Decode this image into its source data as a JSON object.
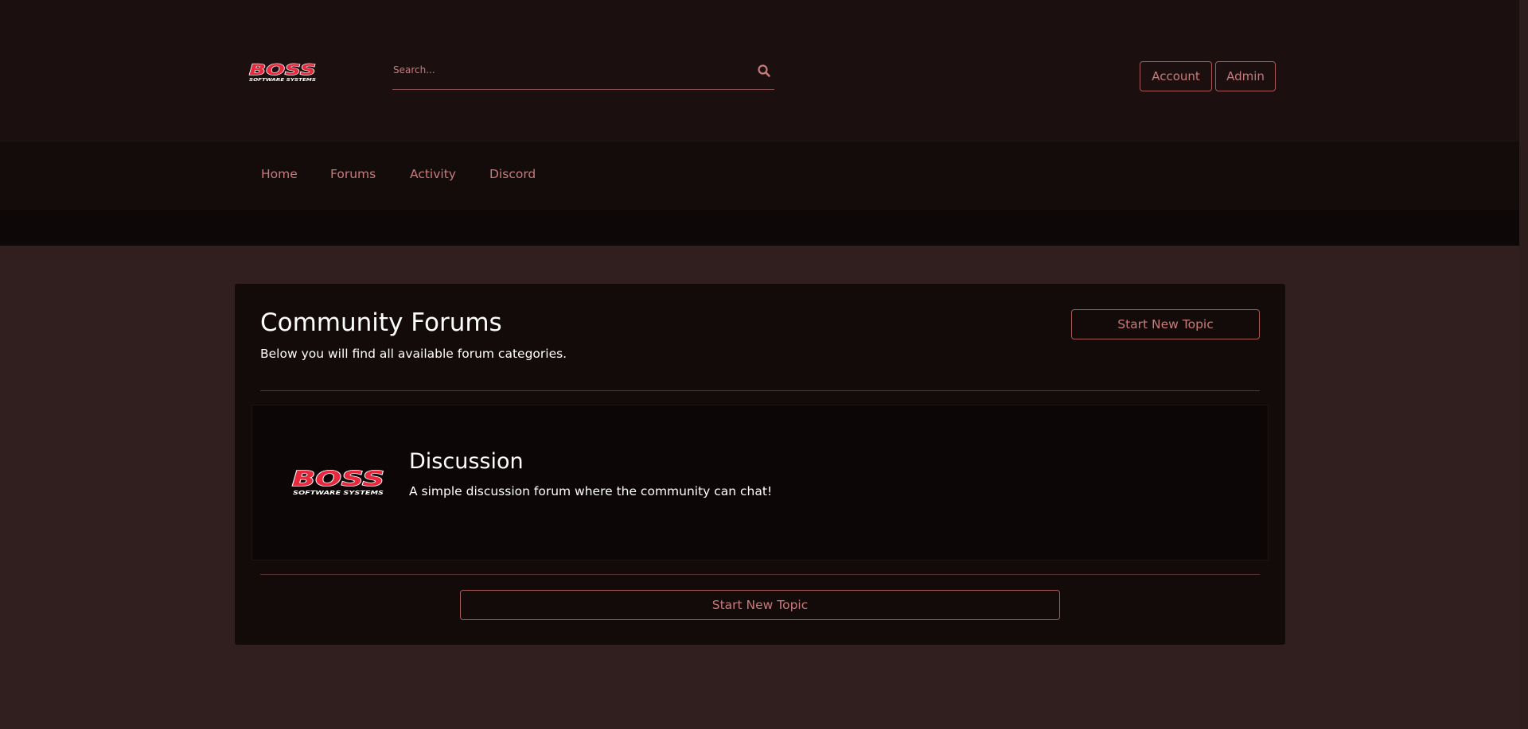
{
  "site": {
    "logo_text": "BOSS",
    "logo_subtext": "SOFTWARE SYSTEMS"
  },
  "header": {
    "search_placeholder": "Search...",
    "search_icon": "search-icon",
    "account_label": "Account",
    "admin_label": "Admin"
  },
  "nav": {
    "items": [
      {
        "label": "Home"
      },
      {
        "label": "Forums"
      },
      {
        "label": "Activity"
      },
      {
        "label": "Discord"
      }
    ]
  },
  "main": {
    "title": "Community Forums",
    "subtitle": "Below you will find all available forum categories.",
    "start_topic_label": "Start New Topic",
    "categories": [
      {
        "name": "Discussion",
        "description": "A simple discussion forum where the community can chat!"
      }
    ],
    "start_topic_bottom_label": "Start New Topic"
  },
  "colors": {
    "accent": "#c87b7b",
    "border": "#a85a5a",
    "page_bg": "#311f20",
    "header_bg": "#1b0f0f",
    "nav_bg": "#140b0b",
    "panel_bg": "#130a0a",
    "logo_red": "#e8283c"
  }
}
